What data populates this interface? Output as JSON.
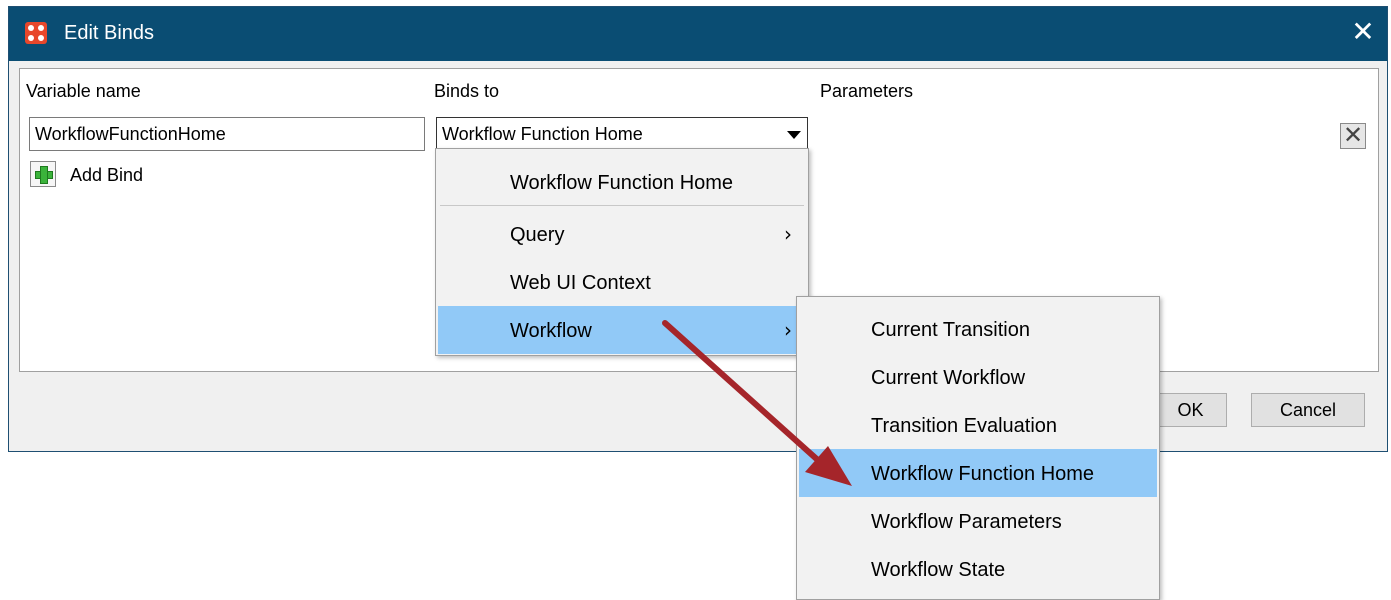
{
  "window": {
    "title": "Edit Binds",
    "close_glyph": "✕"
  },
  "columns": {
    "variable_name": "Variable name",
    "binds_to": "Binds to",
    "parameters": "Parameters"
  },
  "row": {
    "variable_value": "WorkflowFunctionHome",
    "binds_to_value": "Workflow Function Home"
  },
  "add_bind_label": "Add Bind",
  "delete_glyph": "✕",
  "buttons": {
    "ok": "OK",
    "cancel": "Cancel"
  },
  "dropdown_menu": {
    "items": [
      {
        "label": "Workflow Function Home",
        "submenu": false,
        "highlighted": false
      },
      {
        "label": "Query",
        "submenu": true,
        "highlighted": false
      },
      {
        "label": "Web UI Context",
        "submenu": false,
        "highlighted": false
      },
      {
        "label": "Workflow",
        "submenu": true,
        "highlighted": true
      }
    ],
    "submenu_glyph": "›"
  },
  "workflow_submenu": {
    "items": [
      {
        "label": "Current Transition",
        "highlighted": false
      },
      {
        "label": "Current Workflow",
        "highlighted": false
      },
      {
        "label": "Transition Evaluation",
        "highlighted": false
      },
      {
        "label": "Workflow Function Home",
        "highlighted": true
      },
      {
        "label": "Workflow Parameters",
        "highlighted": false
      },
      {
        "label": "Workflow State",
        "highlighted": false
      }
    ]
  },
  "colors": {
    "titlebar": "#0a4d73",
    "highlight": "#91c9f7",
    "annotation_arrow": "#a5252a",
    "app_icon": "#e8472b"
  },
  "icons": {
    "app": "app-logo-icon",
    "close": "close-icon",
    "add": "green-plus-icon",
    "delete": "delete-x-icon",
    "dropdown": "chevron-down-icon",
    "submenu": "chevron-right-icon"
  }
}
